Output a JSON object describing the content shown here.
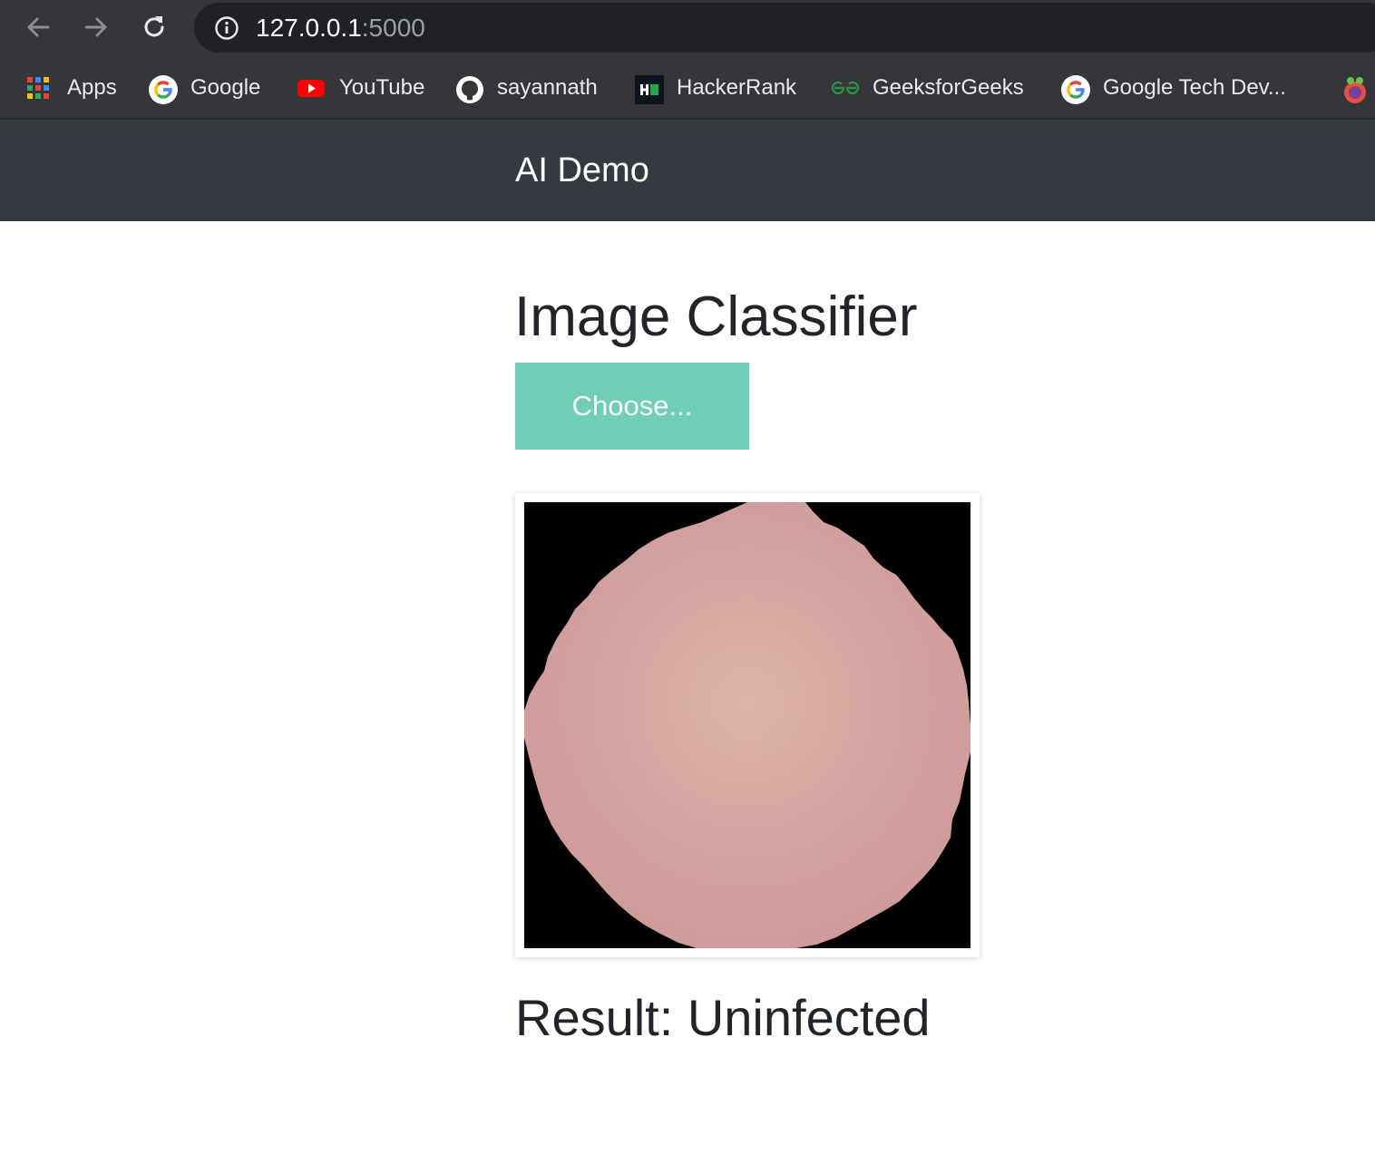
{
  "browser": {
    "url_host": "127.0.0.1",
    "url_port": ":5000",
    "bookmarks": [
      {
        "label": "Apps",
        "icon": "apps-grid-icon"
      },
      {
        "label": "Google",
        "icon": "google-icon"
      },
      {
        "label": "YouTube",
        "icon": "youtube-icon"
      },
      {
        "label": "sayannath",
        "icon": "github-icon"
      },
      {
        "label": "HackerRank",
        "icon": "hackerrank-icon"
      },
      {
        "label": "GeeksforGeeks",
        "icon": "geeksforgeeks-icon"
      },
      {
        "label": "Google Tech Dev...",
        "icon": "google-icon"
      }
    ]
  },
  "navbar": {
    "brand": "AI Demo",
    "background_color": "#343a40"
  },
  "main": {
    "heading": "Image Classifier",
    "choose_button_label": "Choose...",
    "button_color": "#6ecfb6",
    "result_text": "Result: Uninfected"
  }
}
